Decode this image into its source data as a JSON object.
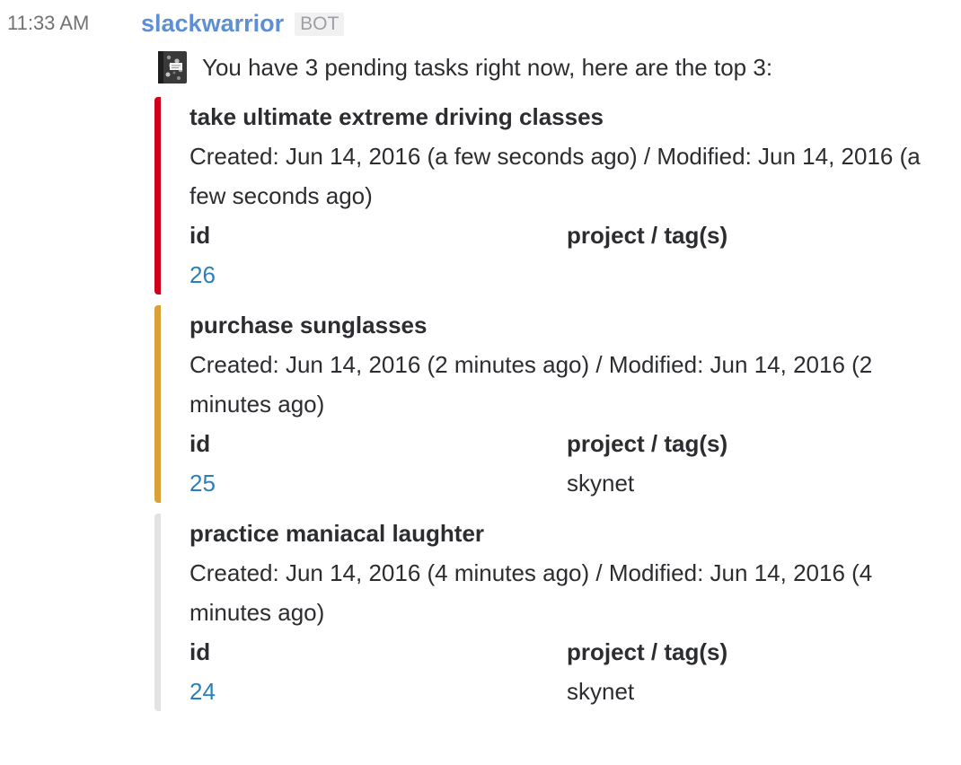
{
  "message": {
    "timestamp": "11:33 AM",
    "sender": "slackwarrior",
    "badge": "BOT",
    "icon": "notebook-icon",
    "text": "You have 3 pending tasks right now, here are the top 3:"
  },
  "labels": {
    "id": "id",
    "project": "project / tag(s)"
  },
  "tasks": [
    {
      "title": "take ultimate extreme driving classes",
      "meta": "Created: Jun 14, 2016 (a few seconds ago) / Modified: Jun 14, 2016 (a few seconds ago)",
      "id": "26",
      "project": "",
      "color": "#d0021b"
    },
    {
      "title": "purchase sunglasses",
      "meta": "Created: Jun 14, 2016 (2 minutes ago) / Modified: Jun 14, 2016 (2 minutes ago)",
      "id": "25",
      "project": "skynet",
      "color": "#daa038"
    },
    {
      "title": "practice maniacal laughter",
      "meta": "Created: Jun 14, 2016 (4 minutes ago) / Modified: Jun 14, 2016 (4 minutes ago)",
      "id": "24",
      "project": "skynet",
      "color": "#e3e3e3"
    }
  ]
}
